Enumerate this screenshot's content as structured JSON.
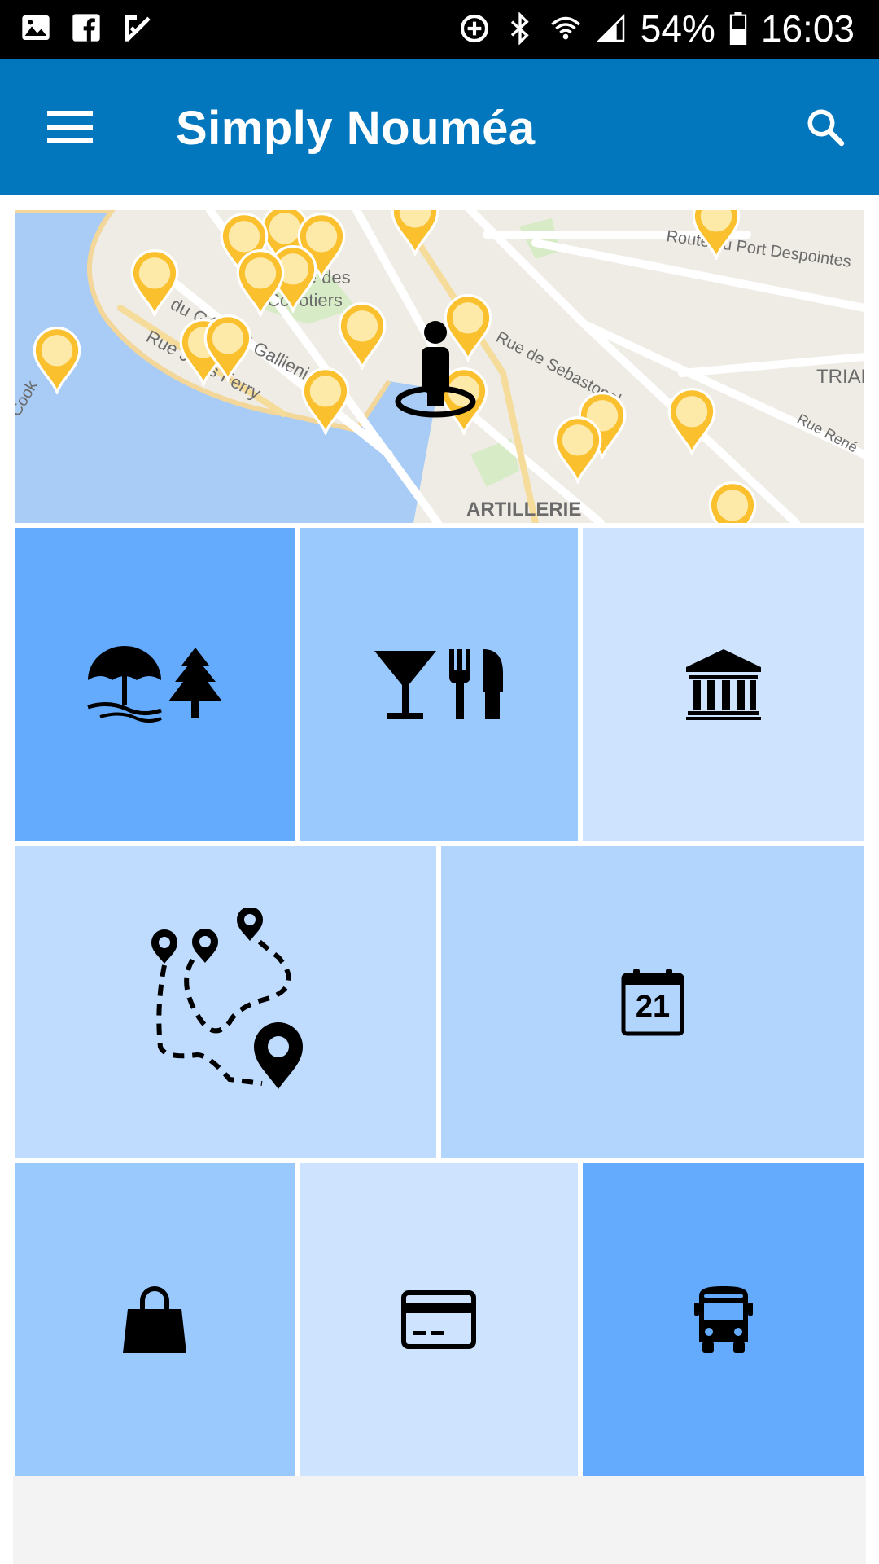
{
  "status_bar": {
    "battery": "54%",
    "time": "16:03",
    "left_icons": [
      "image-icon",
      "facebook-icon",
      "checkmark-notification-icon"
    ],
    "right_icons": [
      "data-saver-icon",
      "bluetooth-icon",
      "wifi-icon",
      "signal-icon",
      "battery-icon"
    ]
  },
  "app_bar": {
    "title": "Simply Nouméa",
    "menu_icon": "hamburger-menu-icon",
    "search_icon": "search-icon",
    "color": "#0277bd"
  },
  "map": {
    "labels": [
      "Route du Port Despointes",
      "Place des Cocotiers",
      "Rue Jules Ferry",
      "Rue du Général Gallieni",
      "Rue de Sebastopol",
      "TRIANON",
      "Rue René",
      "ARTILLERIE",
      "Cook"
    ],
    "user_marker": "person-location-icon",
    "poi_marker_color": "#fbc02d"
  },
  "tiles": [
    {
      "name": "beach-nature-tile",
      "icons": [
        "beach-umbrella-icon",
        "pine-tree-icon"
      ],
      "color": "#64aafd"
    },
    {
      "name": "food-drink-tile",
      "icons": [
        "cocktail-icon",
        "fork-knife-icon"
      ],
      "color": "#9ac9fe"
    },
    {
      "name": "culture-tile",
      "icons": [
        "museum-icon"
      ],
      "color": "#cde3fe"
    },
    {
      "name": "tours-tile",
      "icons": [
        "route-map-icon"
      ],
      "color": "#bfdcfe"
    },
    {
      "name": "events-tile",
      "icons": [
        "calendar-icon"
      ],
      "calendar_day": "21",
      "color": "#b2d5fe"
    },
    {
      "name": "shopping-tile",
      "icons": [
        "shopping-bag-icon"
      ],
      "color": "#9ac9fe"
    },
    {
      "name": "payment-tile",
      "icons": [
        "credit-card-icon"
      ],
      "color": "#cde3fe"
    },
    {
      "name": "transport-tile",
      "icons": [
        "bus-icon"
      ],
      "color": "#64aafd"
    }
  ]
}
